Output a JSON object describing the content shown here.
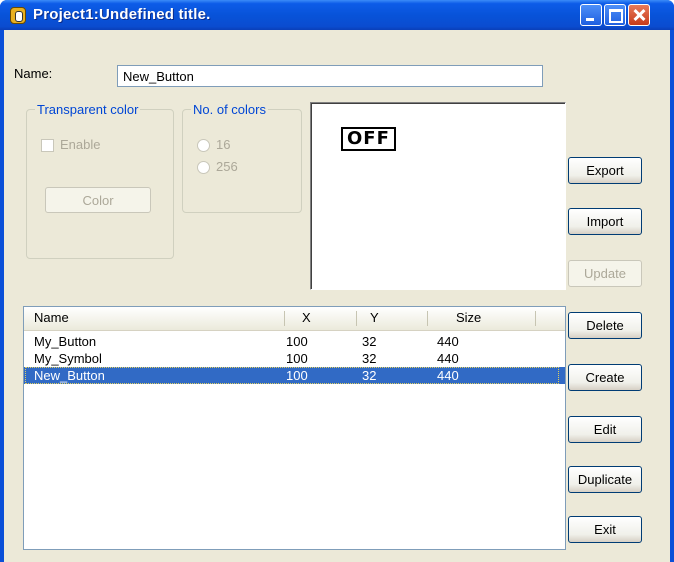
{
  "window": {
    "title": "Project1:Undefined title."
  },
  "name_field": {
    "label": "Name:",
    "value": "New_Button"
  },
  "transparent_color": {
    "label": "Transparent color",
    "enable_label": "Enable",
    "color_button": "Color"
  },
  "num_colors": {
    "label": "No. of colors",
    "options": [
      "16",
      "256"
    ]
  },
  "preview": {
    "text": "OFF"
  },
  "table": {
    "columns": [
      "Name",
      "X",
      "Y",
      "Size"
    ],
    "rows": [
      [
        "My_Button",
        "100",
        "32",
        "440"
      ],
      [
        "My_Symbol",
        "100",
        "32",
        "440"
      ],
      [
        "New_Button",
        "100",
        "32",
        "440"
      ]
    ],
    "selected_row": 2
  },
  "buttons": {
    "export": "Export",
    "import": "Import",
    "update": "Update",
    "delete": "Delete",
    "create": "Create",
    "edit": "Edit",
    "duplicate": "Duplicate",
    "exit": "Exit"
  },
  "colors": {
    "title_bar": "#0a4cd0",
    "selection": "#316ac5",
    "group_label": "#0046d5"
  },
  "icons": [
    "app-icon",
    "minimize-icon",
    "maximize-icon",
    "close-icon"
  ]
}
